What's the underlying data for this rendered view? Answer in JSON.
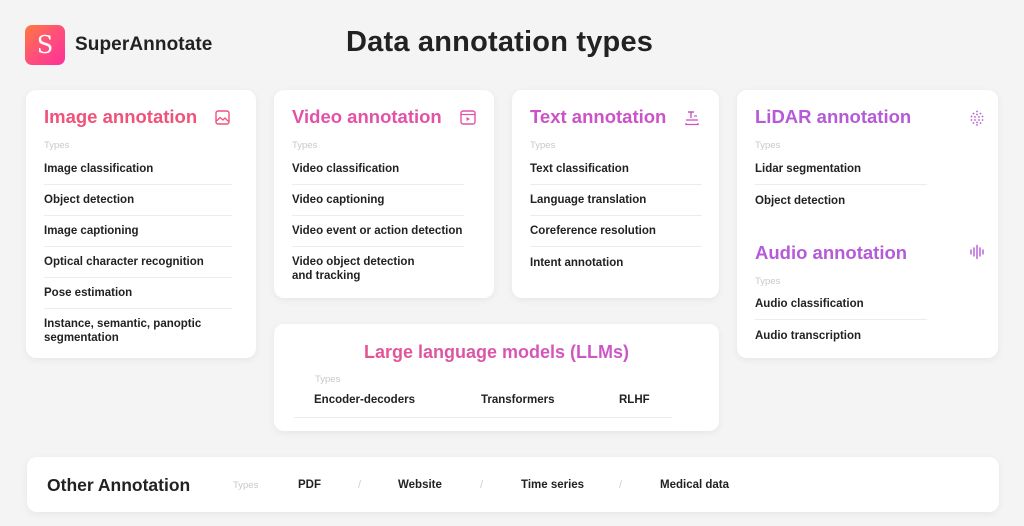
{
  "brand": {
    "name": "SuperAnnotate",
    "logo_letter": "S"
  },
  "page_title": "Data annotation types",
  "types_label": "Types",
  "cards": {
    "image": {
      "title": "Image annotation",
      "icon": "image-icon",
      "items": [
        "Image classification",
        "Object detection",
        "Image captioning",
        "Optical character recognition",
        "Pose estimation",
        "Instance, semantic, panoptic segmentation"
      ]
    },
    "video": {
      "title": "Video annotation",
      "icon": "video-icon",
      "items": [
        "Video classification",
        "Video captioning",
        "Video event or action detection",
        "Video object detection and tracking"
      ]
    },
    "text": {
      "title": "Text annotation",
      "icon": "text-icon",
      "items": [
        "Text classification",
        "Language translation",
        "Coreference resolution",
        "Intent annotation"
      ]
    },
    "lidar": {
      "title": "LiDAR annotation",
      "icon": "point-cloud-icon",
      "items": [
        "Lidar segmentation",
        "Object detection"
      ]
    },
    "audio": {
      "title": "Audio annotation",
      "icon": "waveform-icon",
      "items": [
        "Audio classification",
        "Audio transcription"
      ]
    },
    "llm": {
      "title": "Large language models (LLMs)",
      "items": [
        "Encoder-decoders",
        "Transformers",
        "RLHF"
      ]
    },
    "other": {
      "title": "Other Annotation",
      "items": [
        "PDF",
        "Website",
        "Time series",
        "Medical data"
      ],
      "separator": "/"
    }
  },
  "colors": {
    "image": "#f0527a",
    "video": "#e352a8",
    "text": "#cc52c8",
    "lidar": "#b55ad8",
    "audio": "#b55ad8"
  }
}
